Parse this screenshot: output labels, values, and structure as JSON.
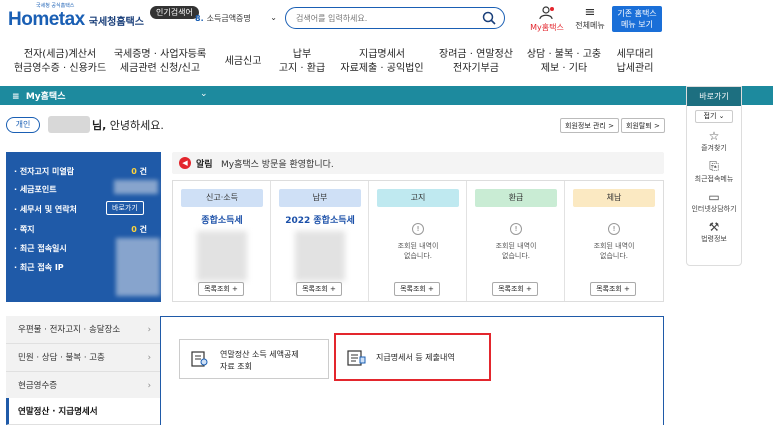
{
  "header": {
    "logo_text": "Hometax",
    "logo_sub": "국세청홈택스",
    "logo_tiny": "국세청 공식홈택스",
    "popular_badge": "인기검색어",
    "popular_rank": "8.",
    "popular_keyword": "소득금액증명",
    "search_placeholder": "검색어를 입력하세요.",
    "my_hometax": "My홈택스",
    "all_menu": "전체메뉴",
    "classic_btn_line1": "기존 홈택스",
    "classic_btn_line2": "메뉴 보기"
  },
  "gnb": [
    {
      "line1": "전자(세금)계산서",
      "line2": "현금영수증 · 신용카드"
    },
    {
      "line1": "국세증명 · 사업자등록",
      "line2": "세금관련 신청/신고"
    },
    {
      "line1": "세금신고",
      "line2": ""
    },
    {
      "line1": "납부",
      "line2": "고지 · 환급"
    },
    {
      "line1": "지급명세서",
      "line2": "자료제출 · 공익법인"
    },
    {
      "line1": "장려금 · 연말정산",
      "line2": "전자기부금"
    },
    {
      "line1": "상담 · 불복 · 고충",
      "line2": "제보 · 기타"
    },
    {
      "line1": "세무대리",
      "line2": "납세관리"
    }
  ],
  "my_bar": {
    "label": "My홈택스"
  },
  "quick": {
    "title": "바로가기",
    "fold": "접기",
    "items": [
      {
        "label": "즐겨찾기"
      },
      {
        "label": "최근접속메뉴"
      },
      {
        "label": "인터넷상담하기"
      },
      {
        "label": "법령정보"
      }
    ]
  },
  "greeting": {
    "role": "개인",
    "name_suffix": "님,",
    "message": " 안녕하세요.",
    "member_info_btn": "회원정보 관리 >",
    "withdraw_btn": "회원탈퇴 >"
  },
  "left_panel": {
    "rows": [
      {
        "label": "· 전자고지 미열람",
        "count": "0",
        "unit": "건"
      },
      {
        "label": "· 세금포인트",
        "count": "",
        "unit": ""
      },
      {
        "label": "· 세무서 및 연락처",
        "count": "",
        "unit": ""
      },
      {
        "label": "· 쪽지",
        "count": "0",
        "unit": "건"
      },
      {
        "label": "· 최근 접속일시",
        "count": "",
        "unit": ""
      },
      {
        "label": "· 최근 접속 IP",
        "count": "",
        "unit": ""
      }
    ],
    "contact_btn": "바로가기"
  },
  "notice": {
    "label": "알림",
    "text": "My홈택스 방문을 환영합니다."
  },
  "cards": [
    {
      "head": "신고·소득",
      "sub": "종합소득세",
      "color": "#cfe0f6",
      "empty": false,
      "btn": "목록조회 +"
    },
    {
      "head": "납부",
      "sub": "2022 종합소득세",
      "color": "#cfe0f6",
      "empty": false,
      "btn": "목록조회 +"
    },
    {
      "head": "고지",
      "sub": "",
      "color": "#bfe9f0",
      "empty": true,
      "empty_line1": "조회된 내역이",
      "empty_line2": "없습니다.",
      "btn": "목록조회 +"
    },
    {
      "head": "환급",
      "sub": "",
      "color": "#c9ecd4",
      "empty": true,
      "empty_line1": "조회된 내역이",
      "empty_line2": "없습니다.",
      "btn": "목록조회 +"
    },
    {
      "head": "체납",
      "sub": "",
      "color": "#fbe9c2",
      "empty": true,
      "empty_line1": "조회된 내역이",
      "empty_line2": "없습니다.",
      "btn": "목록조회 +"
    }
  ],
  "left_menu": [
    {
      "label": "우편물 · 전자고지 · 송달장소",
      "active": false
    },
    {
      "label": "민원 · 상담 · 불복 · 고충",
      "active": false
    },
    {
      "label": "현금영수증",
      "active": false
    },
    {
      "label": "연말정산 · 지급명세서",
      "active": true
    }
  ],
  "sub_cards": [
    {
      "line1": "연말정산 소득 세액공제",
      "line2": "자료 조회"
    },
    {
      "line1": "지급명세서 등 제출내역",
      "line2": ""
    }
  ]
}
